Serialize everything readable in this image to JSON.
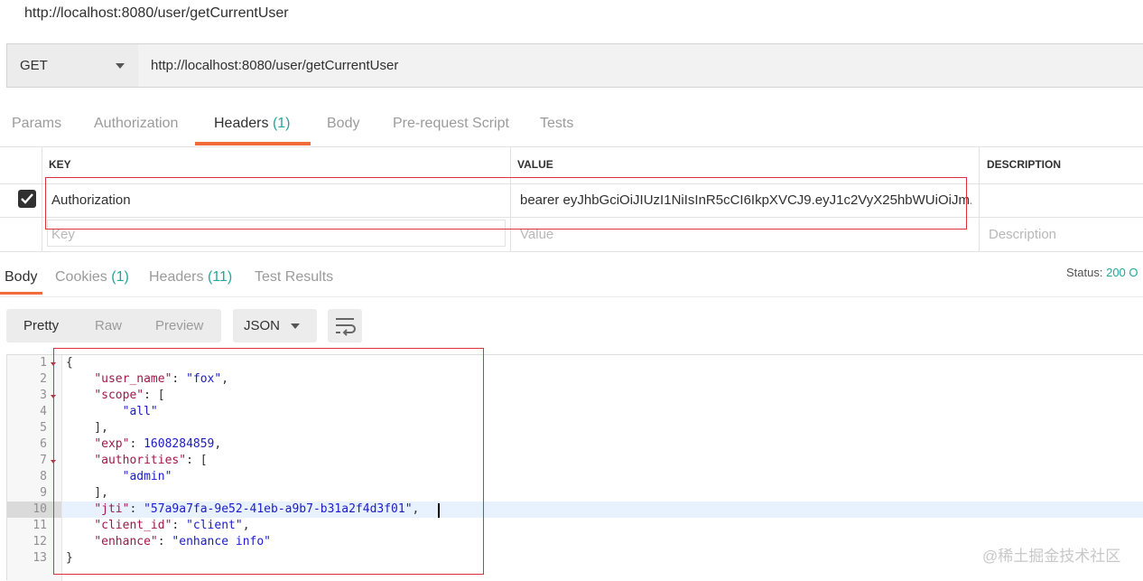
{
  "window": {
    "title": "http://localhost:8080/user/getCurrentUser"
  },
  "request": {
    "method": "GET",
    "url": "http://localhost:8080/user/getCurrentUser"
  },
  "request_tabs": [
    {
      "label": "Params",
      "count": ""
    },
    {
      "label": "Authorization",
      "count": ""
    },
    {
      "label": "Headers",
      "count": "(1)"
    },
    {
      "label": "Body",
      "count": ""
    },
    {
      "label": "Pre-request Script",
      "count": ""
    },
    {
      "label": "Tests",
      "count": ""
    }
  ],
  "active_request_tab": "Headers",
  "headers_table": {
    "columns": [
      "KEY",
      "VALUE",
      "DESCRIPTION"
    ],
    "rows": [
      {
        "checked": true,
        "key": "Authorization",
        "value": "bearer eyJhbGciOiJIUzI1NiIsInR5cCI6IkpXVCJ9.eyJ1c2VyX25hbWUiOiJm...",
        "description": ""
      }
    ],
    "new_row": {
      "key_placeholder": "Key",
      "value_placeholder": "Value",
      "description_placeholder": "Description"
    }
  },
  "response_tabs": [
    {
      "label": "Body",
      "count": ""
    },
    {
      "label": "Cookies",
      "count": "(1)"
    },
    {
      "label": "Headers",
      "count": "(11)"
    },
    {
      "label": "Test Results",
      "count": ""
    }
  ],
  "status": {
    "label": "Status:",
    "value": "200 O"
  },
  "view_buttons": [
    "Pretty",
    "Raw",
    "Preview"
  ],
  "format": "JSON",
  "icons": {
    "wrap": "wrap-lines-icon",
    "check": "check-icon",
    "caret": "chevron-down-icon"
  },
  "colors": {
    "accent": "#f26b3a",
    "count": "#26a69a",
    "highlight_box": "#d9323a"
  },
  "code_lines": [
    {
      "n": "1",
      "text": "{"
    },
    {
      "n": "2",
      "text": "    \"user_name\": \"fox\","
    },
    {
      "n": "3",
      "text": "    \"scope\": ["
    },
    {
      "n": "4",
      "text": "        \"all\""
    },
    {
      "n": "5",
      "text": "    ],"
    },
    {
      "n": "6",
      "text": "    \"exp\": 1608284859,"
    },
    {
      "n": "7",
      "text": "    \"authorities\": ["
    },
    {
      "n": "8",
      "text": "        \"admin\""
    },
    {
      "n": "9",
      "text": "    ],"
    },
    {
      "n": "10",
      "text": "    \"jti\": \"57a9a7fa-9e52-41eb-a9b7-b31a2f4d3f01\","
    },
    {
      "n": "11",
      "text": "    \"client_id\": \"client\","
    },
    {
      "n": "12",
      "text": "    \"enhance\": \"enhance info\""
    },
    {
      "n": "13",
      "text": "}"
    }
  ],
  "watermark": "@稀土掘金技术社区"
}
